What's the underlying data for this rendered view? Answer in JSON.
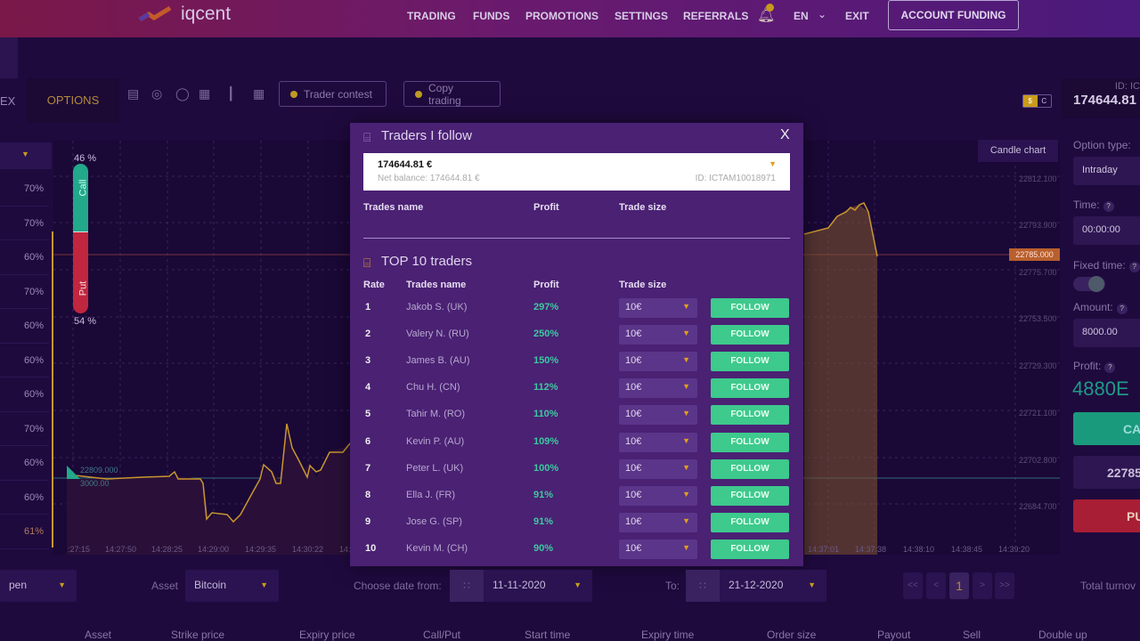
{
  "header": {
    "logo": "iqcent",
    "nav": [
      "TRADING",
      "FUNDS",
      "PROMOTIONS",
      "SETTINGS",
      "REFERRALS"
    ],
    "notifications": "1",
    "lang": "EN",
    "exit": "EXIT",
    "account_funding": "ACCOUNT FUNDING"
  },
  "toolbar": {
    "tab_prev": "EX",
    "tab_options": "OPTIONS",
    "trader_contest": "Trader contest",
    "copy_trading": "Copy trading",
    "currency_s": "$",
    "currency_c": "C",
    "id_label": "ID: IC",
    "balance": "174644.81"
  },
  "left_panel": {
    "payouts": [
      "70%",
      "70%",
      "60%",
      "70%",
      "60%",
      "60%",
      "60%",
      "70%",
      "60%",
      "60%",
      "61%"
    ]
  },
  "chart": {
    "call_pct": "46 %",
    "put_pct": "54 %",
    "call_label": "Call",
    "put_label": "Put",
    "candle_chart": "Candle chart",
    "current_price": "22785.000",
    "open_price": "22809.000",
    "open_amount": "3000.00",
    "y_ticks": [
      "22812.100",
      "22793.900",
      "22775.700",
      "22753.500",
      "22729.300",
      "22721.100",
      "22702.800",
      "22684.700"
    ],
    "x_ticks_left": [
      ":27:15",
      "14:27:50",
      "14:28:25",
      "14:29:00",
      "14:29:35",
      "14:30:22",
      "14:"
    ],
    "x_ticks_right": [
      "14:37:01",
      "14:37:38",
      "14:38:10",
      "14:38:45",
      "14:39:20"
    ],
    "call_share": 46,
    "colors": {
      "call": "#22a88a",
      "put": "#c0263e",
      "line": "#c9962e"
    }
  },
  "modal": {
    "title": "Traders I follow",
    "close": "X",
    "account": {
      "balance": "174644.81 €",
      "net_balance": "Net balance: 174644.81 €",
      "id": "ID: ICTAM10018971"
    },
    "follow_headers": [
      "Trades name",
      "Profit",
      "Trade size"
    ],
    "top_title": "TOP 10 traders",
    "top_headers": [
      "Rate",
      "Trades name",
      "Profit",
      "Trade size"
    ],
    "follow_label": "FOLLOW",
    "traders": [
      {
        "rate": "1",
        "name": "Jakob S. (UK)",
        "profit": "297%",
        "size": "10€"
      },
      {
        "rate": "2",
        "name": "Valery N. (RU)",
        "profit": "250%",
        "size": "10€"
      },
      {
        "rate": "3",
        "name": "James B. (AU)",
        "profit": "150%",
        "size": "10€"
      },
      {
        "rate": "4",
        "name": "Chu H. (CN)",
        "profit": "112%",
        "size": "10€"
      },
      {
        "rate": "5",
        "name": "Tahir M. (RO)",
        "profit": "110%",
        "size": "10€"
      },
      {
        "rate": "6",
        "name": "Kevin P. (AU)",
        "profit": "109%",
        "size": "10€"
      },
      {
        "rate": "7",
        "name": "Peter L. (UK)",
        "profit": "100%",
        "size": "10€"
      },
      {
        "rate": "8",
        "name": "Ella J. (FR)",
        "profit": "91%",
        "size": "10€"
      },
      {
        "rate": "9",
        "name": "Jose G. (SP)",
        "profit": "91%",
        "size": "10€"
      },
      {
        "rate": "10",
        "name": "Kevin M. (CH)",
        "profit": "90%",
        "size": "10€"
      }
    ]
  },
  "right_panel": {
    "option_type_label": "Option type:",
    "option_type": "Intraday",
    "time_label": "Time:",
    "time": "00:00:00",
    "fixed_time_label": "Fixed time:",
    "amount_label": "Amount:",
    "amount": "8000.00",
    "profit_label": "Profit:",
    "profit": "4880E",
    "call_btn": "CA",
    "price": "22785",
    "put_btn": "PU",
    "help": "?"
  },
  "filters": {
    "status": "pen",
    "asset_label": "Asset",
    "asset": "Bitcoin",
    "date_from_label": "Choose date from:",
    "date_from": "11-11-2020",
    "to_label": "To:",
    "date_to": "21-12-2020",
    "pages": [
      "<<",
      "<",
      "1",
      ">",
      ">>"
    ],
    "total_turnover": "Total turnov"
  },
  "table": {
    "columns": [
      "Asset",
      "Strike price",
      "Expiry price",
      "Call/Put",
      "Start time",
      "Expiry time",
      "Order size",
      "Payout",
      "Sell",
      "Double up"
    ]
  }
}
